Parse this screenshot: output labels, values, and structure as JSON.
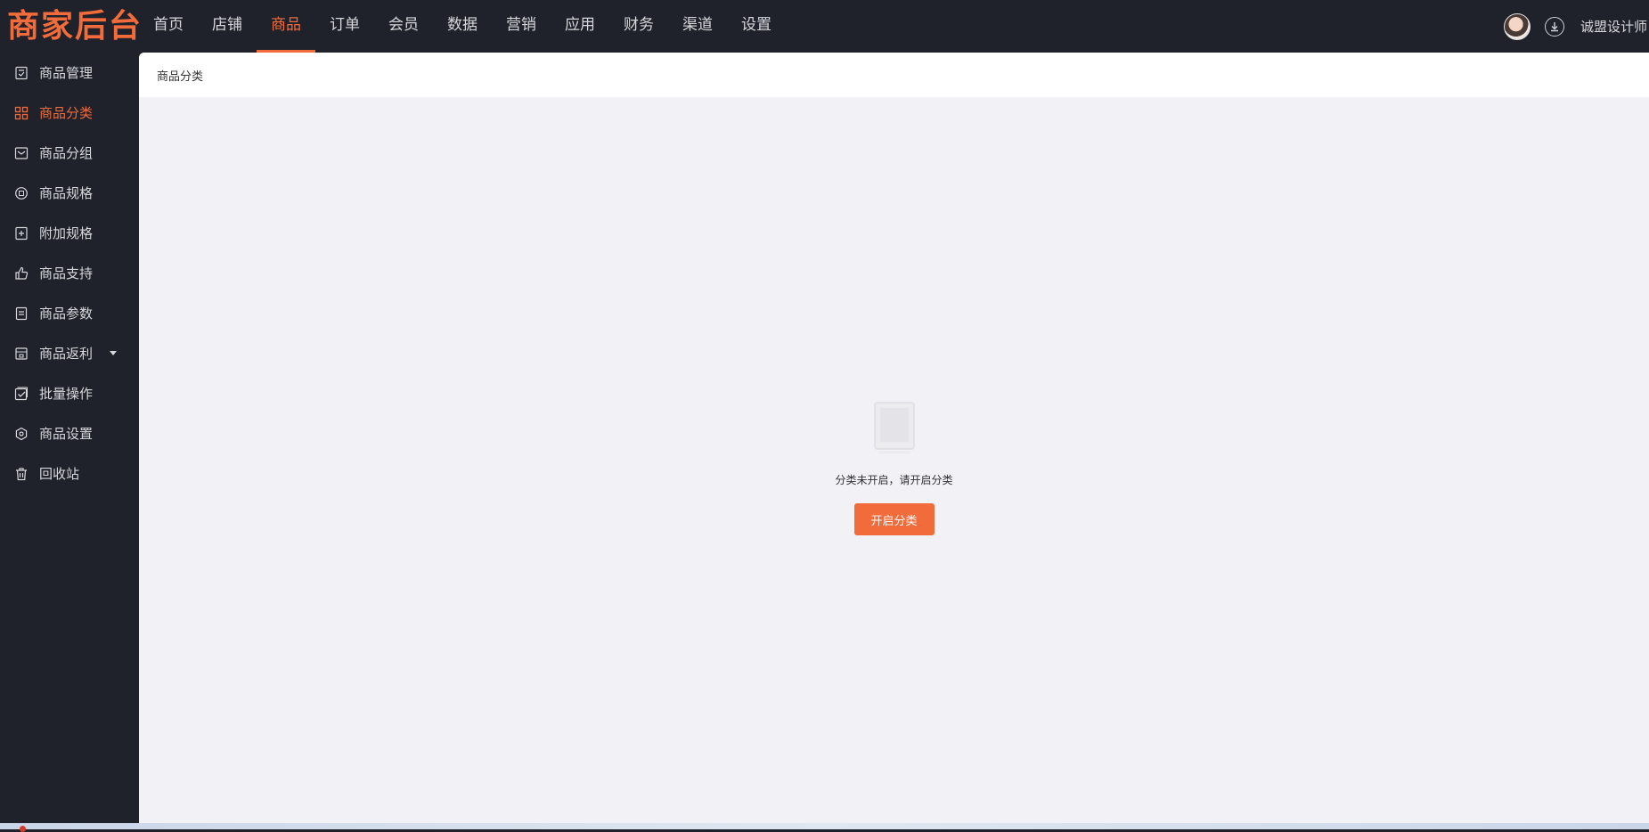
{
  "app": {
    "logo_text": "商家后台",
    "brand_color": "#f26b3a"
  },
  "topnav": {
    "items": [
      {
        "label": "首页"
      },
      {
        "label": "店铺"
      },
      {
        "label": "商品",
        "active": true
      },
      {
        "label": "订单"
      },
      {
        "label": "会员"
      },
      {
        "label": "数据"
      },
      {
        "label": "营销"
      },
      {
        "label": "应用"
      },
      {
        "label": "财务"
      },
      {
        "label": "渠道"
      },
      {
        "label": "设置"
      }
    ]
  },
  "user": {
    "name": "诚盟设计师",
    "avatar_icon": "avatar-icon",
    "download_icon": "download-icon"
  },
  "sidebar": {
    "items": [
      {
        "label": "商品管理",
        "icon": "goods-manage-icon"
      },
      {
        "label": "商品分类",
        "icon": "grid-icon",
        "active": true
      },
      {
        "label": "商品分组",
        "icon": "group-icon"
      },
      {
        "label": "商品规格",
        "icon": "spec-icon"
      },
      {
        "label": "附加规格",
        "icon": "plus-square-icon"
      },
      {
        "label": "商品支持",
        "icon": "thumbs-up-icon"
      },
      {
        "label": "商品参数",
        "icon": "document-icon"
      },
      {
        "label": "商品返利",
        "icon": "rebate-icon",
        "has_submenu": true
      },
      {
        "label": "批量操作",
        "icon": "batch-check-icon"
      },
      {
        "label": "商品设置",
        "icon": "hexagon-settings-icon"
      },
      {
        "label": "回收站",
        "icon": "trash-icon"
      }
    ]
  },
  "main": {
    "breadcrumb": "商品分类",
    "empty_text": "分类未开启，请开启分类",
    "enable_button": "开启分类"
  }
}
